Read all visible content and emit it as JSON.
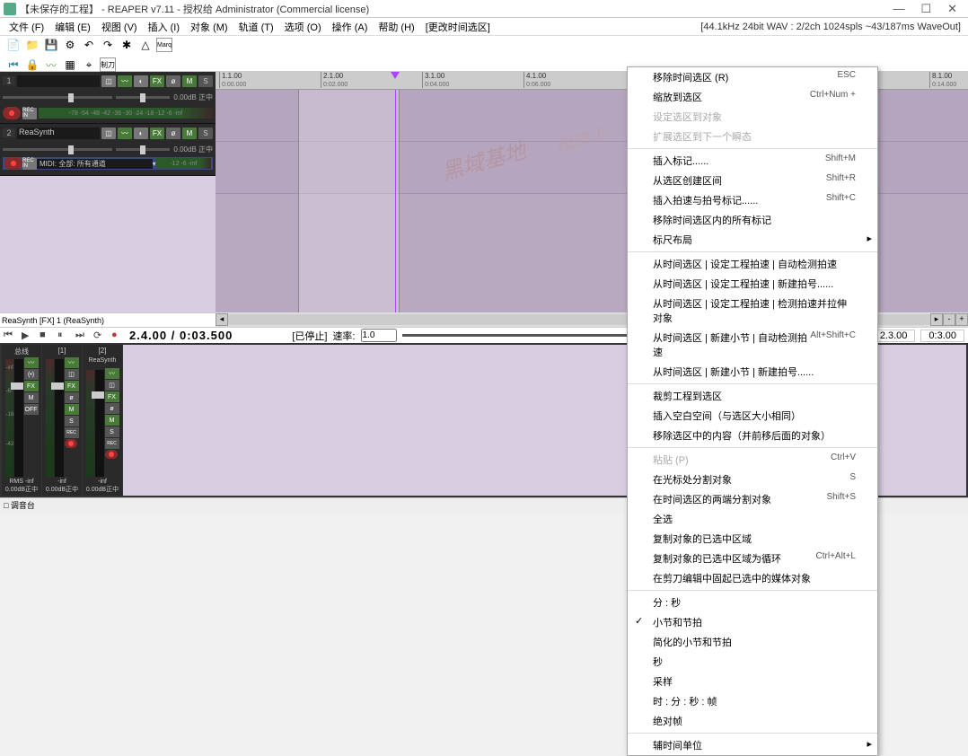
{
  "title": "【未保存的工程】 - REAPER v7.11 - 授权给 Administrator (Commercial license)",
  "menu": [
    "文件 (F)",
    "编辑 (E)",
    "视图 (V)",
    "插入 (I)",
    "对象 (M)",
    "轨道 (T)",
    "选项 (O)",
    "操作 (A)",
    "帮助 (H)",
    "[更改时间选区]"
  ],
  "status_right": "[44.1kHz 24bit WAV : 2/2ch 1024spls ~43/187ms WaveOut]",
  "ruler": [
    {
      "pos": 4,
      "bar": "1.1.00",
      "time": "0:00.000"
    },
    {
      "pos": 117,
      "bar": "2.1.00",
      "time": "0:02.000"
    },
    {
      "pos": 230,
      "bar": "3.1.00",
      "time": "0:04.000"
    },
    {
      "pos": 343,
      "bar": "4.1.00",
      "time": "0:06.000"
    },
    {
      "pos": 795,
      "bar": "8.1.00",
      "time": "0:14.000"
    }
  ],
  "tracks": [
    {
      "num": "1",
      "name": "",
      "db": "0.00dB 正中",
      "meters": "-78 -54 -48 -42 -36 -30 -24 -18 -12 -6  -inf"
    },
    {
      "num": "2",
      "name": "ReaSynth",
      "db": "0.00dB 正中",
      "meters": "-12  -6  -inf",
      "midi": "MIDI: 全部: 所有通道"
    }
  ],
  "strip_label": "ReaSynth [FX] 1 (ReaSynth)",
  "transport": {
    "big_time": "2.4.00 / 0:03.500",
    "state": "[已停止]",
    "rate_label": "速率:",
    "rate": "1.0"
  },
  "ruler2": [
    "2.3.00",
    "0:3.00"
  ],
  "mixer": [
    {
      "title": "总线",
      "bottom1": "RMS -inf",
      "bottom2": "0.00dB正中"
    },
    {
      "title": "[1]",
      "bottom1": "-inf",
      "bottom2": "0.00dB正中"
    },
    {
      "title": "[2]",
      "name": "ReaSynth",
      "bottom1": "-inf",
      "bottom2": "0.00dB正中"
    }
  ],
  "bottom_bar": "□ 调音台",
  "context_menu": [
    {
      "label": "移除时间选区 (R)",
      "shortcut": "ESC"
    },
    {
      "label": "缩放到选区",
      "shortcut": "Ctrl+Num +"
    },
    {
      "label": "设定选区到对象",
      "disabled": true
    },
    {
      "label": "扩展选区到下一个瞬态",
      "disabled": true
    },
    {
      "sep": true
    },
    {
      "label": "插入标记......",
      "shortcut": "Shift+M"
    },
    {
      "label": "从选区创建区间",
      "shortcut": "Shift+R"
    },
    {
      "label": "插入拍速与拍号标记......",
      "shortcut": "Shift+C"
    },
    {
      "label": "移除时间选区内的所有标记"
    },
    {
      "label": "标尺布局",
      "sub": true
    },
    {
      "sep": true
    },
    {
      "label": "从时间选区 | 设定工程拍速 | 自动检测拍速"
    },
    {
      "label": "从时间选区 | 设定工程拍速 | 新建拍号......"
    },
    {
      "label": "从时间选区 | 设定工程拍速 | 检测拍速并拉伸对象"
    },
    {
      "label": "从时间选区 | 新建小节 | 自动检测拍速",
      "shortcut": "Alt+Shift+C"
    },
    {
      "label": "从时间选区 | 新建小节 | 新建拍号......"
    },
    {
      "sep": true
    },
    {
      "label": "裁剪工程到选区"
    },
    {
      "label": "插入空白空间（与选区大小相同）"
    },
    {
      "label": "移除选区中的内容（并前移后面的对象）"
    },
    {
      "sep": true
    },
    {
      "label": "粘贴 (P)",
      "shortcut": "Ctrl+V",
      "disabled": true
    },
    {
      "label": "在光标处分割对象",
      "shortcut": "S"
    },
    {
      "label": "在时间选区的两端分割对象",
      "shortcut": "Shift+S"
    },
    {
      "label": "全选"
    },
    {
      "label": "复制对象的已选中区域"
    },
    {
      "label": "复制对象的已选中区域为循环",
      "shortcut": "Ctrl+Alt+L"
    },
    {
      "label": "在剪刀编辑中固起已选中的媒体对象"
    },
    {
      "sep": true
    },
    {
      "label": "分 : 秒"
    },
    {
      "label": "小节和节拍",
      "check": true
    },
    {
      "label": "简化的小节和节拍"
    },
    {
      "label": "秒"
    },
    {
      "label": "采样"
    },
    {
      "label": "时 : 分 : 秒 : 帧"
    },
    {
      "label": "绝对帧"
    },
    {
      "sep": true
    },
    {
      "label": "辅时间单位",
      "sub": true
    }
  ]
}
